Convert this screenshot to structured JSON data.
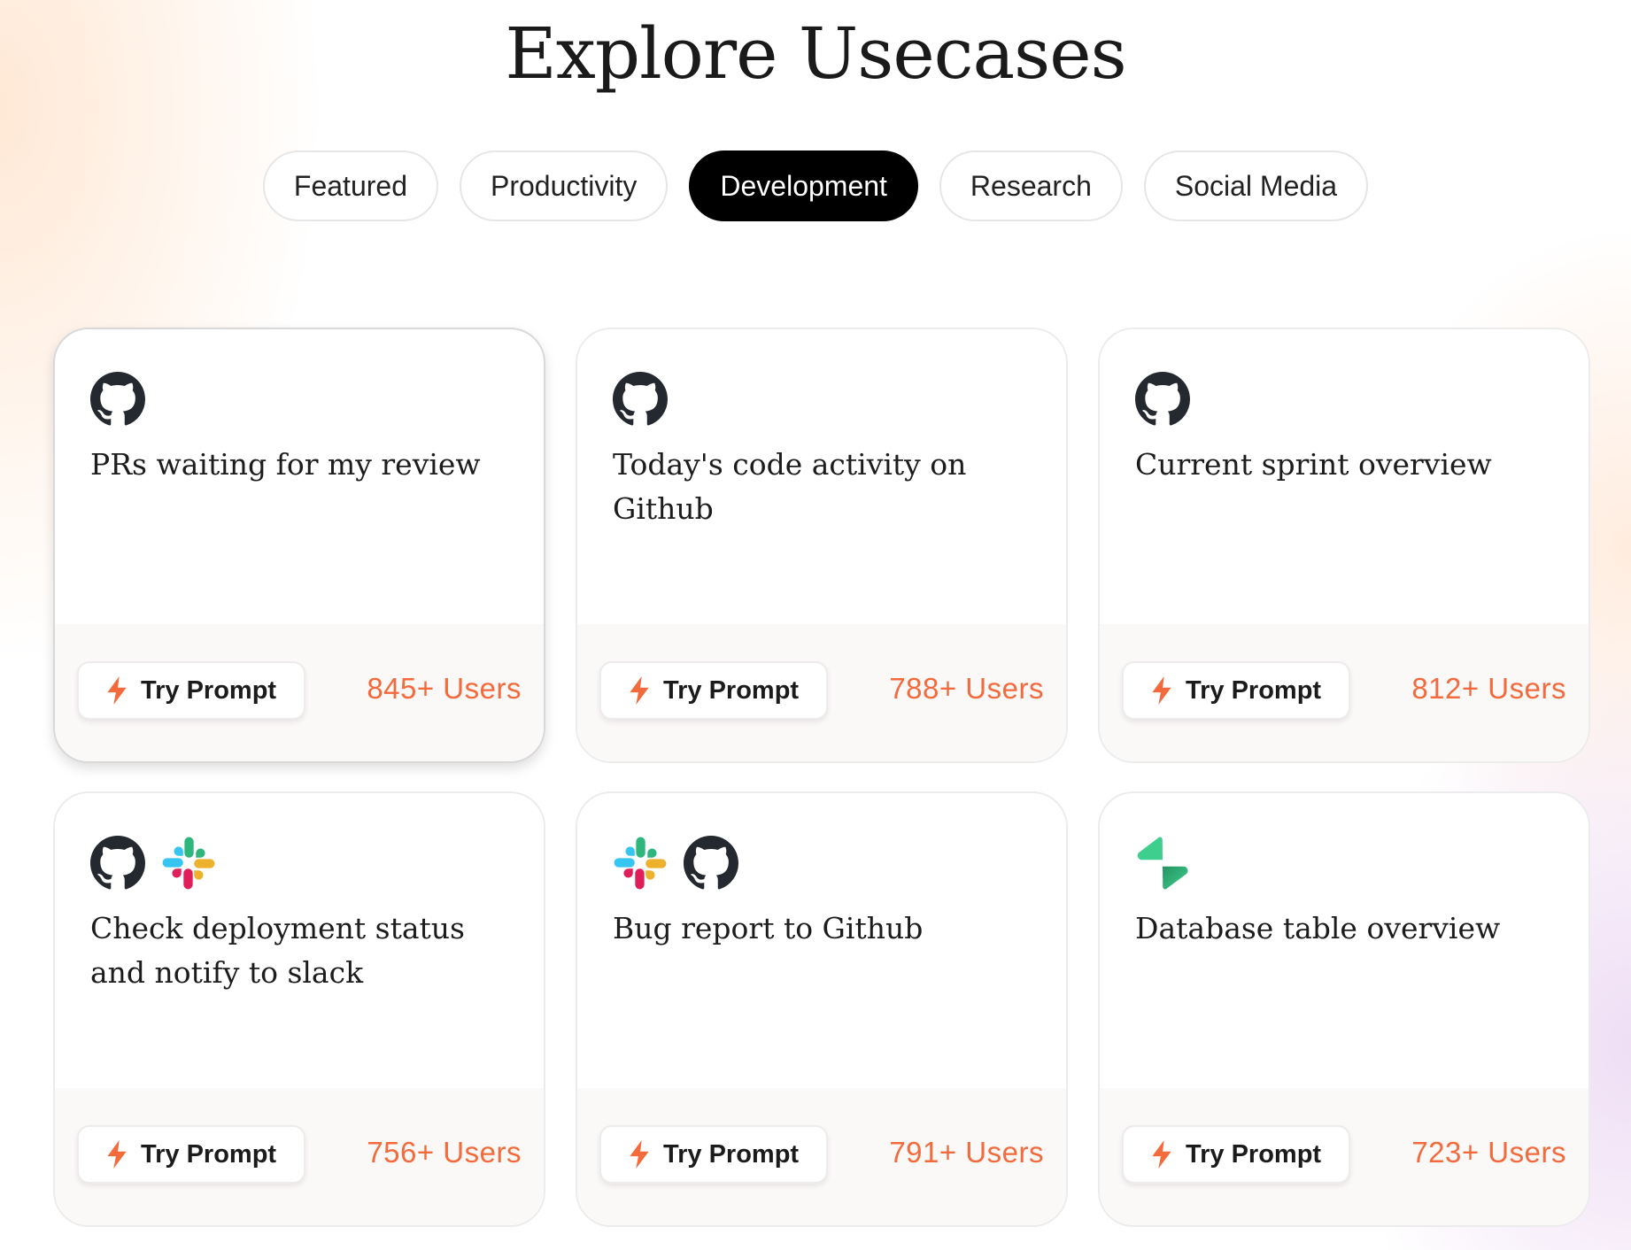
{
  "page": {
    "title": "Explore Usecases"
  },
  "tabs": [
    {
      "label": "Featured",
      "active": false
    },
    {
      "label": "Productivity",
      "active": false
    },
    {
      "label": "Development",
      "active": true
    },
    {
      "label": "Research",
      "active": false
    },
    {
      "label": "Social Media",
      "active": false
    }
  ],
  "colors": {
    "accent": "#f36a3c",
    "active_tab_bg": "#000000",
    "github": "#24292f",
    "supabase": "#3ecf8e"
  },
  "cards": [
    {
      "icons": [
        "github-icon"
      ],
      "title": "PRs waiting for my review",
      "button_label": "Try Prompt",
      "users": "845+ Users"
    },
    {
      "icons": [
        "github-icon"
      ],
      "title": "Today's code activity on Github",
      "button_label": "Try Prompt",
      "users": "788+ Users"
    },
    {
      "icons": [
        "github-icon"
      ],
      "title": "Current sprint overview",
      "button_label": "Try Prompt",
      "users": "812+ Users"
    },
    {
      "icons": [
        "github-icon",
        "slack-icon"
      ],
      "title": "Check deployment status and notify to slack",
      "button_label": "Try Prompt",
      "users": "756+ Users"
    },
    {
      "icons": [
        "slack-icon",
        "github-icon"
      ],
      "title": "Bug report to Github",
      "button_label": "Try Prompt",
      "users": "791+ Users"
    },
    {
      "icons": [
        "supabase-icon"
      ],
      "title": "Database table overview",
      "button_label": "Try Prompt",
      "users": "723+ Users"
    }
  ]
}
